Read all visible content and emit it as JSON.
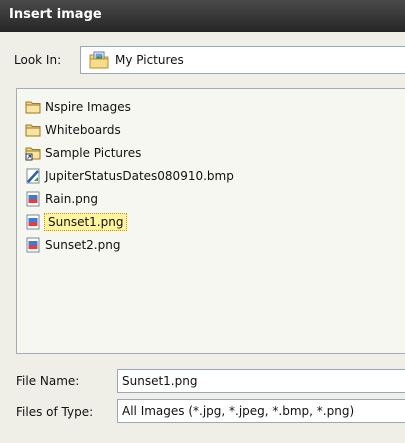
{
  "window": {
    "title": "Insert image"
  },
  "look_in": {
    "label": "Look In:",
    "value": "My Pictures"
  },
  "files": [
    {
      "name": "Nspire Images",
      "icon": "folder-icon"
    },
    {
      "name": "Whiteboards",
      "icon": "folder-icon"
    },
    {
      "name": "Sample Pictures",
      "icon": "folder-shortcut-icon"
    },
    {
      "name": "JupiterStatusDates080910.bmp",
      "icon": "bmp-file-icon"
    },
    {
      "name": "Rain.png",
      "icon": "png-file-icon"
    },
    {
      "name": "Sunset1.png",
      "icon": "png-file-icon",
      "selected": true
    },
    {
      "name": "Sunset2.png",
      "icon": "png-file-icon"
    }
  ],
  "file_name": {
    "label": "File Name:",
    "value": "Sunset1.png"
  },
  "file_type": {
    "label": "Files of Type:",
    "value": "All Images (*.jpg, *.jpeg, *.bmp, *.png)"
  },
  "colors": {
    "selection": "#fff59e",
    "titlebar": "#333333"
  }
}
